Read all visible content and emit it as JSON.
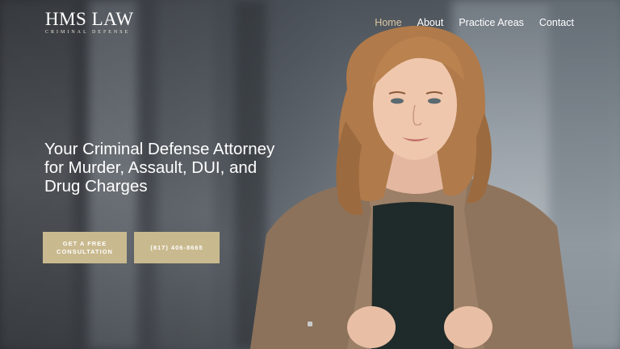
{
  "logo": {
    "main": "HMS LAW",
    "sub": "CRIMINAL DEFENSE"
  },
  "nav": {
    "items": [
      {
        "label": "Home",
        "active": true
      },
      {
        "label": "About",
        "active": false
      },
      {
        "label": "Practice Areas",
        "active": false
      },
      {
        "label": "Contact",
        "active": false
      }
    ]
  },
  "hero": {
    "headline": "Your Criminal Defense Attorney for Murder, Assault, DUI, and Drug Charges",
    "consult_button": "GET A FREE CONSULTATION",
    "phone_button": "(817) 406-8665"
  },
  "colors": {
    "accent": "#c9b98e",
    "nav_active": "#d9c7a2",
    "text": "#ffffff"
  }
}
